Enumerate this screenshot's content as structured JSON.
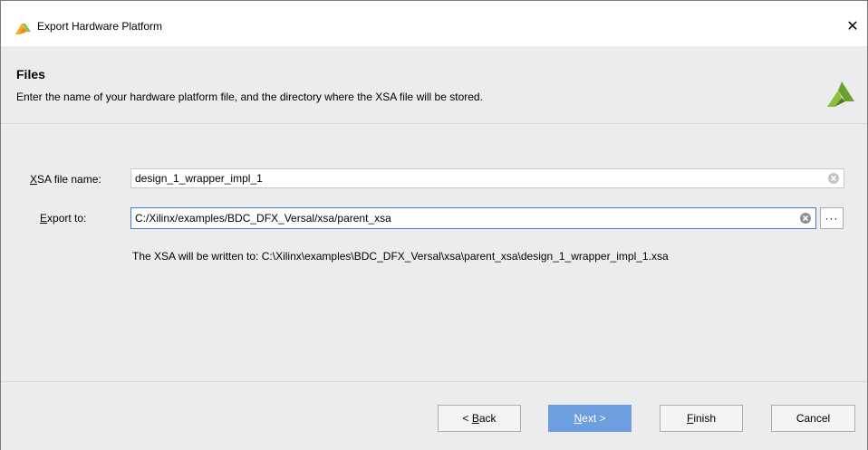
{
  "window": {
    "title": "Export Hardware Platform",
    "close_glyph": "✕"
  },
  "header": {
    "title": "Files",
    "description": "Enter the name of your hardware platform file, and the directory where the XSA file will be stored."
  },
  "form": {
    "xsa_label_access": "X",
    "xsa_label_rest": "SA file name:",
    "xsa_value": "design_1_wrapper_impl_1",
    "export_label_access": "E",
    "export_label_rest": "xport to:",
    "export_value": "C:/Xilinx/examples/BDC_DFX_Versal/xsa/parent_xsa",
    "browse_label": "···",
    "output_note": "The XSA will be written to: C:\\Xilinx\\examples\\BDC_DFX_Versal\\xsa\\parent_xsa\\design_1_wrapper_impl_1.xsa"
  },
  "buttons": {
    "back_prefix": "< ",
    "back_access": "B",
    "back_rest": "ack",
    "next_access": "N",
    "next_rest": "ext >",
    "finish_access": "F",
    "finish_rest": "inish",
    "cancel": "Cancel"
  },
  "colors": {
    "accent": "#3c7fd6",
    "primary_button": "#6d9ee0",
    "header_background": "#ececec"
  },
  "icons": {
    "app": "vivado-logo-icon",
    "header_logo": "xilinx-logo-icon",
    "clear": "clear-circle-icon",
    "close": "close-icon"
  }
}
